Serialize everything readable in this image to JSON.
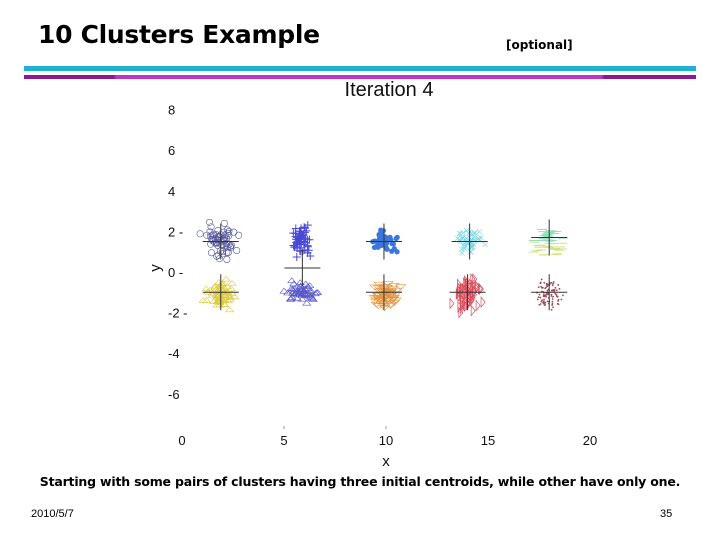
{
  "slide": {
    "title": "10 Clusters Example",
    "tag": "[optional]",
    "caption": "Starting with some pairs of clusters having three initial centroids, while other have only one.",
    "date": "2010/5/7",
    "page_number": "35",
    "accent_colors": {
      "rule_top": "#1fb1cf",
      "rule_bottom": "#c233c4"
    }
  },
  "chart_data": {
    "type": "scatter",
    "title": "Iteration 4",
    "xlabel": "x",
    "ylabel": "y",
    "xlim": [
      0,
      20
    ],
    "ylim": [
      -6,
      8
    ],
    "xticks": [
      0,
      5,
      10,
      15,
      20
    ],
    "yticks": [
      8,
      6,
      4,
      2,
      0,
      -2,
      -4,
      -6
    ],
    "ytick_labels": [
      "8",
      "6",
      "4",
      "2 -",
      "0 -",
      "-2 -",
      "-4",
      "-6"
    ],
    "grid": false,
    "legend": "none",
    "clusters": [
      {
        "name": "cluster-1",
        "marker": "circle-open",
        "color": "#3a3a8c",
        "center": [
          1.9,
          1.5
        ],
        "spread": [
          0.7,
          0.75
        ],
        "count": 60
      },
      {
        "name": "cluster-2",
        "marker": "triangle-open",
        "color": "#d8c21a",
        "center": [
          1.9,
          -1.1
        ],
        "spread": [
          0.6,
          0.55
        ],
        "count": 60
      },
      {
        "name": "cluster-3",
        "marker": "plus",
        "color": "#2a2ad0",
        "center": [
          5.9,
          1.5
        ],
        "spread": [
          0.45,
          0.6
        ],
        "count": 55
      },
      {
        "name": "cluster-4",
        "marker": "triangle-open",
        "color": "#3a3ac0",
        "center": [
          5.9,
          -1.0
        ],
        "spread": [
          0.65,
          0.4
        ],
        "count": 55
      },
      {
        "name": "cluster-5",
        "marker": "circle-filled",
        "color": "#1a5fd6",
        "center": [
          9.9,
          1.5
        ],
        "spread": [
          0.55,
          0.45
        ],
        "count": 45
      },
      {
        "name": "cluster-6",
        "marker": "triangle-down",
        "color": "#e0821e",
        "center": [
          9.9,
          -1.2
        ],
        "spread": [
          0.6,
          0.55
        ],
        "count": 60
      },
      {
        "name": "cluster-7",
        "marker": "x",
        "color": "#5fd0e0",
        "center": [
          14.1,
          1.5
        ],
        "spread": [
          0.55,
          0.55
        ],
        "count": 50
      },
      {
        "name": "cluster-8",
        "marker": "triangle-right",
        "color": "#d03040",
        "center": [
          14.0,
          -1.1
        ],
        "spread": [
          0.6,
          0.7
        ],
        "count": 60
      },
      {
        "name": "cluster-9",
        "marker": "dash",
        "color": "#7fd8b0",
        "center": [
          18.0,
          1.5
        ],
        "spread": [
          0.55,
          0.7
        ],
        "count": 50
      },
      {
        "name": "cluster-10",
        "marker": "dot",
        "color": "#8a2a3a",
        "center": [
          18.0,
          -1.1
        ],
        "spread": [
          0.55,
          0.75
        ],
        "count": 90
      }
    ],
    "centroids": [
      {
        "name": "centroid-1",
        "x": 1.9,
        "y": 1.5
      },
      {
        "name": "centroid-2",
        "x": 1.9,
        "y": -1.0
      },
      {
        "name": "centroid-3",
        "x": 5.9,
        "y": 0.2
      },
      {
        "name": "centroid-4",
        "x": 9.9,
        "y": 1.5
      },
      {
        "name": "centroid-5",
        "x": 9.9,
        "y": -1.0
      },
      {
        "name": "centroid-6",
        "x": 14.1,
        "y": 1.5
      },
      {
        "name": "centroid-7",
        "x": 14.0,
        "y": -1.0
      },
      {
        "name": "centroid-8",
        "x": 18.0,
        "y": 1.7
      },
      {
        "name": "centroid-9",
        "x": 18.0,
        "y": -1.0
      }
    ]
  }
}
